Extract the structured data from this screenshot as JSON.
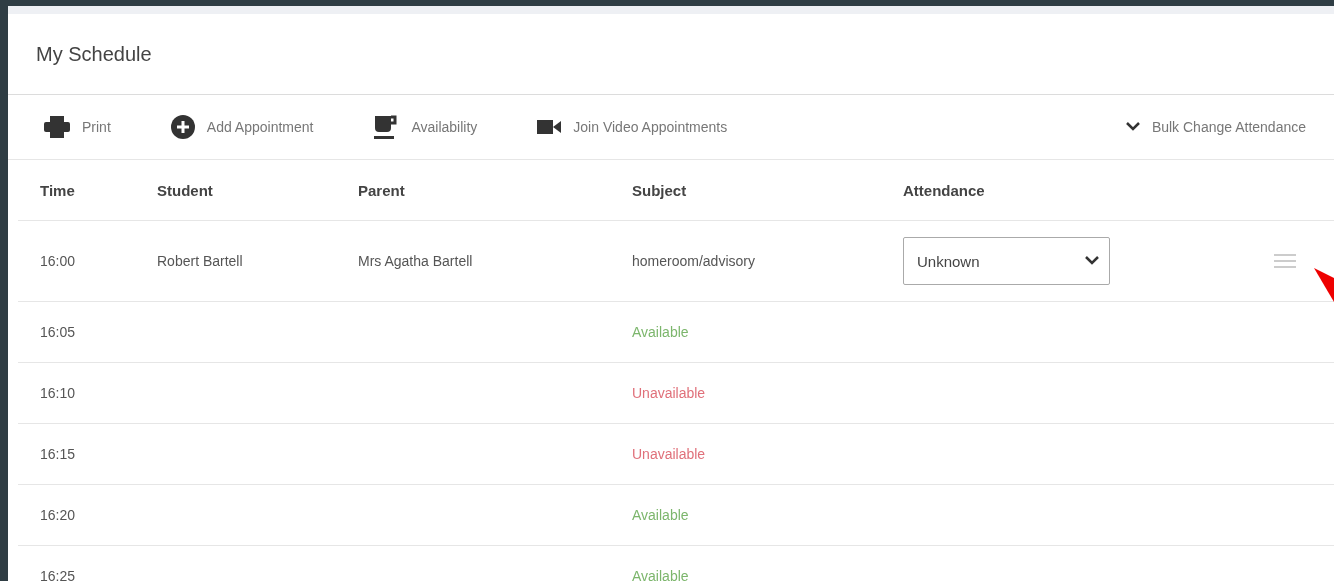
{
  "title": "My Schedule",
  "toolbar": [
    {
      "kind": "print",
      "label": "Print"
    },
    {
      "kind": "add",
      "label": "Add Appointment"
    },
    {
      "kind": "availability",
      "label": "Availability"
    },
    {
      "kind": "video",
      "label": "Join Video Appointments"
    }
  ],
  "bulk_action": {
    "label": "Bulk Change Attendance"
  },
  "table": {
    "columns": [
      "Time",
      "Student",
      "Parent",
      "Subject",
      "Attendance"
    ],
    "rows": [
      {
        "kind": "appointment",
        "time": "16:00",
        "student": "Robert Bartell",
        "parent": "Mrs Agatha Bartell",
        "subject": "homeroom/advisory",
        "attendance": "Unknown"
      },
      {
        "kind": "slot",
        "time": "16:05",
        "subject": "Available",
        "color": "#7cb66c"
      },
      {
        "kind": "slot",
        "time": "16:10",
        "subject": "Unavailable",
        "color": "#e0707a"
      },
      {
        "kind": "slot",
        "time": "16:15",
        "subject": "Unavailable",
        "color": "#e0707a"
      },
      {
        "kind": "slot",
        "time": "16:20",
        "subject": "Available",
        "color": "#7cb66c"
      },
      {
        "kind": "slot",
        "time": "16:25",
        "subject": "Available",
        "color": "#7cb66c"
      }
    ]
  }
}
